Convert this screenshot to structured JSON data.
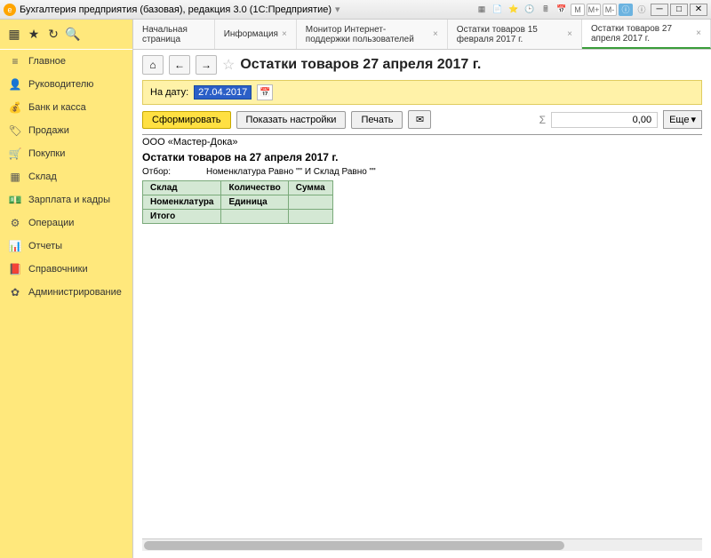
{
  "titlebar": {
    "title": "Бухгалтерия предприятия (базовая), редакция 3.0  (1С:Предприятие)"
  },
  "sidebar": {
    "items": [
      {
        "icon": "≡",
        "label": "Главное"
      },
      {
        "icon": "👤",
        "label": "Руководителю"
      },
      {
        "icon": "💰",
        "label": "Банк и касса"
      },
      {
        "icon": "🏷",
        "label": "Продажи"
      },
      {
        "icon": "🛒",
        "label": "Покупки"
      },
      {
        "icon": "▦",
        "label": "Склад"
      },
      {
        "icon": "💵",
        "label": "Зарплата и кадры"
      },
      {
        "icon": "⚙",
        "label": "Операции"
      },
      {
        "icon": "📊",
        "label": "Отчеты"
      },
      {
        "icon": "📕",
        "label": "Справочники"
      },
      {
        "icon": "✿",
        "label": "Администрирование"
      }
    ]
  },
  "tabs": [
    {
      "label": "Начальная страница",
      "closable": false
    },
    {
      "label": "Информация",
      "closable": true
    },
    {
      "label": "Монитор Интернет-поддержки пользователей",
      "closable": true
    },
    {
      "label": "Остатки товаров 15 февраля 2017 г.",
      "closable": true
    },
    {
      "label": "Остатки товаров 27 апреля 2017 г.",
      "closable": true
    }
  ],
  "page": {
    "title": "Остатки товаров 27 апреля 2017 г.",
    "date_label": "На дату:",
    "date_value": "27.04.2017",
    "btn_generate": "Сформировать",
    "btn_settings": "Показать настройки",
    "btn_print": "Печать",
    "sum_value": "0,00",
    "btn_more": "Еще"
  },
  "report": {
    "org": "ООО «Мастер-Дока»",
    "title": "Остатки товаров на 27 апреля 2017 г.",
    "filter_label": "Отбор:",
    "filter_value": "Номенклатура Равно \"\" И Склад Равно \"\"",
    "headers": {
      "r1c1": "Склад",
      "r1c2": "Количество",
      "r1c3": "Сумма",
      "r2c1": "Номенклатура",
      "r2c2": "Единица",
      "total": "Итого"
    }
  }
}
